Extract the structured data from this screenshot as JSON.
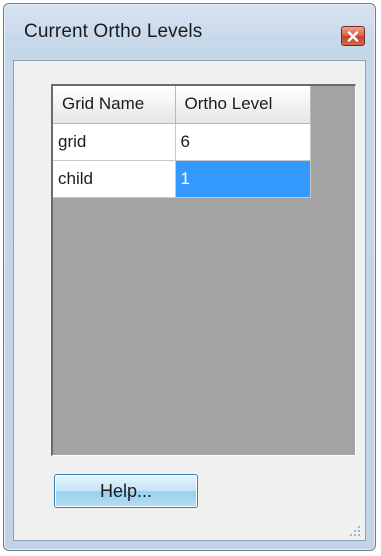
{
  "window": {
    "title": "Current Ortho Levels"
  },
  "grid": {
    "columns": [
      "Grid Name",
      "Ortho Level"
    ],
    "rows": [
      {
        "name": "grid",
        "level": "6"
      },
      {
        "name": "child",
        "level": "1"
      }
    ],
    "selected_row": 1
  },
  "buttons": {
    "help_label": "Help..."
  },
  "icons": {
    "close": "close-icon",
    "resize": "resize-grip-icon"
  },
  "colors": {
    "selection": "#3399ff",
    "grid_background": "#a3a3a3",
    "title_bar": "#c6d7ea",
    "close_button": "#d4603f"
  }
}
